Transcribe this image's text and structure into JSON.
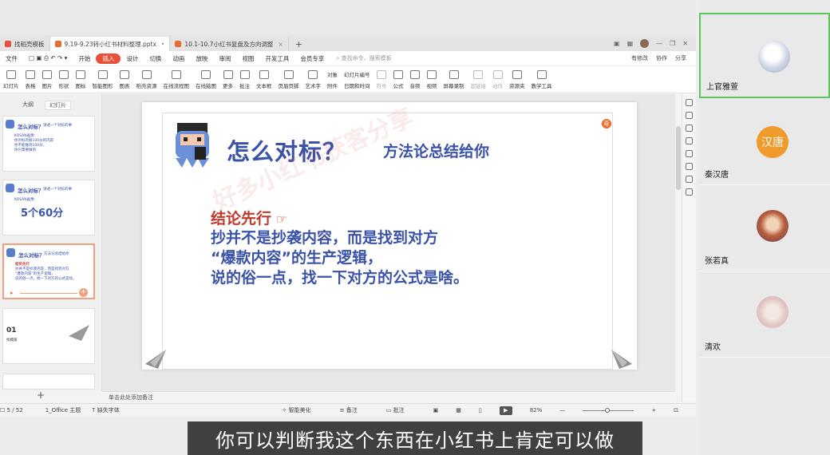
{
  "tabs": [
    {
      "label": "找稻壳模板",
      "color": "#e8503a",
      "active": false
    },
    {
      "label": "9.19-9.23转小红书材料整理.pptx",
      "color": "#e86d2c",
      "active": true
    },
    {
      "label": "10.1-10.7小红书复盘及方向调整",
      "color": "#e86d2c",
      "active": false
    }
  ],
  "menu": {
    "items": [
      "文件",
      "开始",
      "插入",
      "设计",
      "切换",
      "动画",
      "放映",
      "审阅",
      "视图",
      "开发工具",
      "会员专享"
    ],
    "active": "插入",
    "search_placeholder": "查找命令、搜索模板",
    "right": [
      "有修改",
      "协作",
      "分享"
    ]
  },
  "ribbon": {
    "items": [
      "幻灯片",
      "表格",
      "图片",
      "形状",
      "图标",
      "智能图形",
      "图表",
      "稻壳资源",
      "在线流程图",
      "在线脑图",
      "更多",
      "批注",
      "文本框",
      "页眉页脚",
      "艺术字",
      "符号",
      "公式",
      "音频",
      "视频",
      "屏幕录制",
      "超链接",
      "动作",
      "资源夹",
      "教学工具"
    ],
    "stacks": [
      [
        "对象",
        "附件"
      ],
      [
        "幻灯片编号",
        "日期和时间"
      ]
    ]
  },
  "thumbnails": {
    "view_tabs": [
      "大纲",
      "幻灯片"
    ],
    "slides": [
      {
        "title": "怎么对标？",
        "subtitle": "讲透一个对标的事",
        "body": [
          "KOSAN画像：",
          "你对标的账100分的内容",
          "你不能做到100分，",
          "你只需要做到"
        ]
      },
      {
        "title": "怎么对标？",
        "subtitle": "讲透一个对标的事",
        "label": "KOSAN画像：",
        "big": "5个60分"
      },
      {
        "title": "怎么对标？",
        "subtitle": "方法论总结给你",
        "red": "结论先行",
        "body": [
          "抄并不是抄袭内容，而是找到对方",
          "“爆款内容”的生产逻辑，",
          "说的俗一点，找一下对方的公式是啥。"
        ]
      },
      {
        "num": "01",
        "sub": "找模版"
      }
    ]
  },
  "slide": {
    "title": "怎么对标？",
    "subtitle": "方法论总结给你",
    "conclusion": "结论先行",
    "lines": [
      "抄并不是抄袭内容，而是找到对方",
      "“爆款内容”的生产逻辑，",
      "说的俗一点，找一下对方的公式是啥。"
    ],
    "watermark": "好多小红书获客分享",
    "badge": "奇"
  },
  "notes_placeholder": "单击此处添加备注",
  "status": {
    "slide_count": "5 / 52",
    "theme": "1_Office 主题",
    "font_warning": "缺失字体",
    "beautify": "智能美化",
    "notes": "备注",
    "comments": "批注",
    "zoom": "82%"
  },
  "caption": "你可以判断我这个东西在小红书上肯定可以做",
  "participants": [
    {
      "name": "上官雅萱",
      "speaking": true,
      "avatar_color": "#dfe4ef"
    },
    {
      "name": "秦汉唐",
      "speaking": false,
      "avatar_text": "汉唐"
    },
    {
      "name": "张若真",
      "speaking": false,
      "avatar_color": "#c57d5c"
    },
    {
      "name": "清欢",
      "speaking": false,
      "avatar_color": "#e6d0cf"
    }
  ]
}
